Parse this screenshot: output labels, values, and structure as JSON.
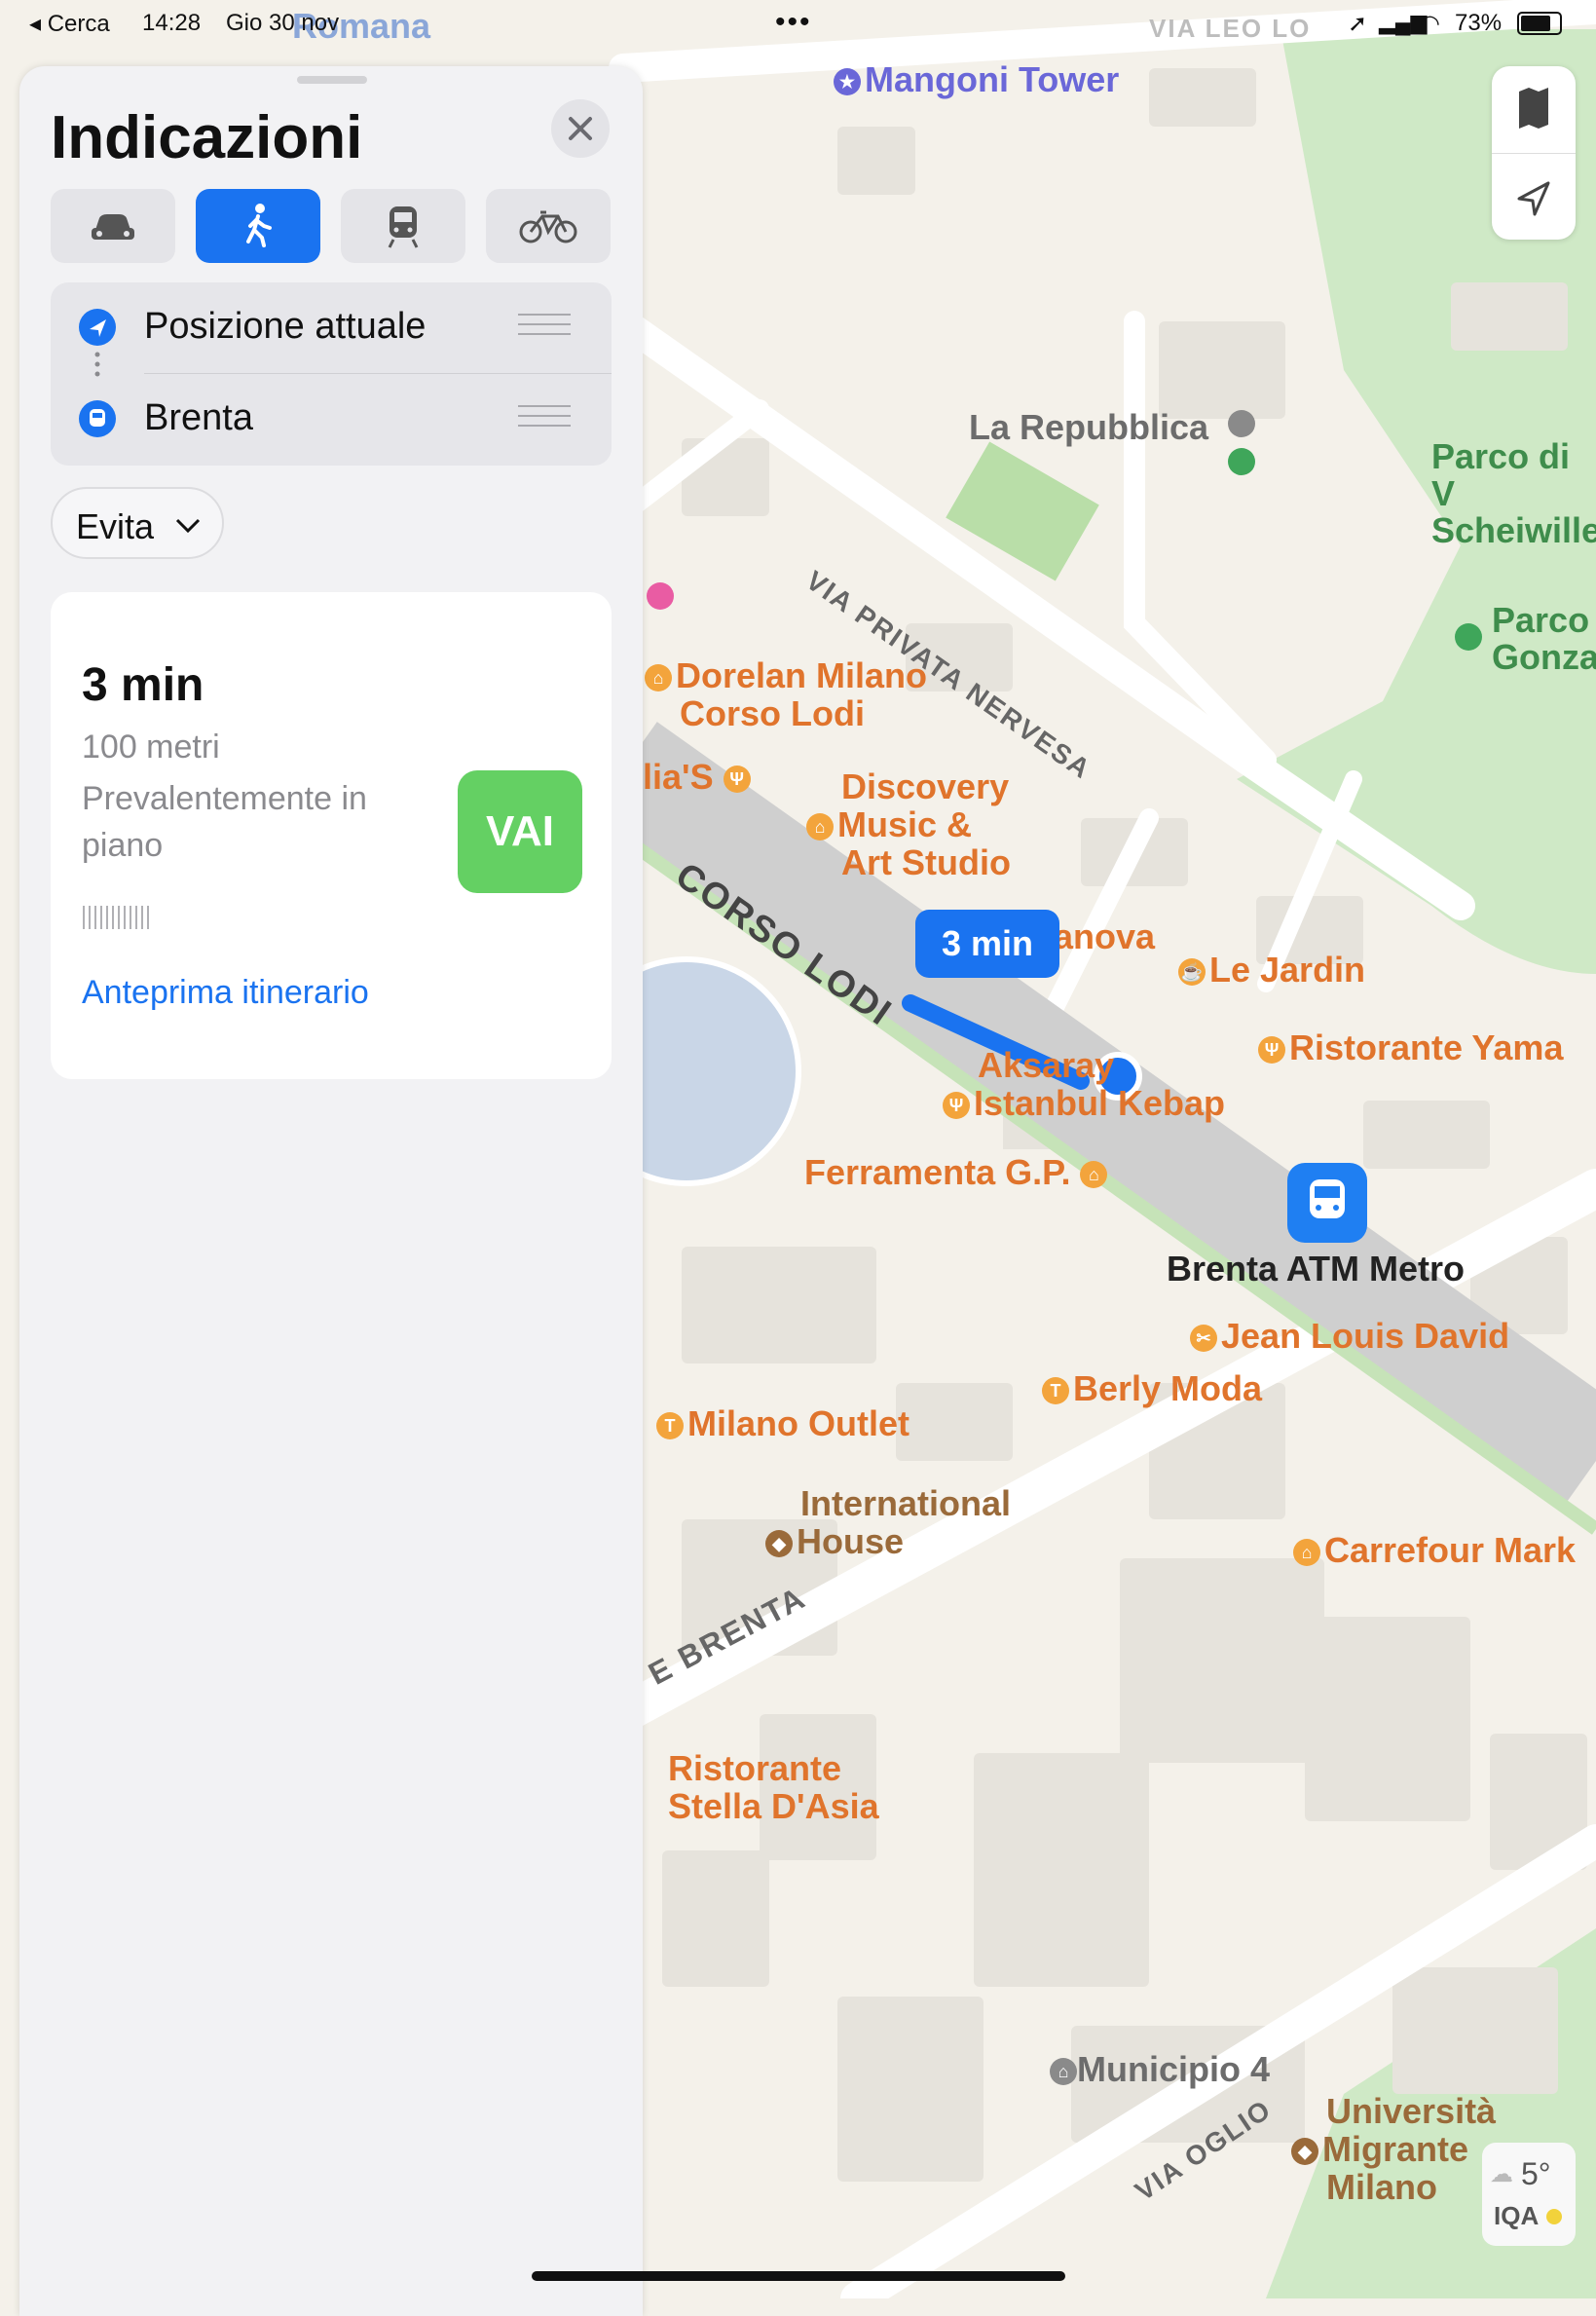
{
  "status_bar": {
    "back_app": "◂ Cerca",
    "time": "14:28",
    "date": "Gio 30 nov",
    "battery": "73%"
  },
  "panel": {
    "title": "Indicazioni",
    "modes": [
      "car",
      "walk",
      "transit",
      "bike"
    ],
    "active_mode": "walk",
    "origin": "Posizione attuale",
    "destination": "Brenta",
    "avoid_label": "Evita",
    "route": {
      "time": "3 min",
      "distance": "100 metri",
      "description": "Prevalentemente in piano",
      "go_label": "VAI",
      "preview_label": "Anteprima itinerario"
    }
  },
  "map": {
    "route_bubble": "3 min",
    "pois": {
      "mangoni": "Mangoni Tower",
      "repubblica": "La Repubblica",
      "parco1_line1": "Parco di V",
      "parco1_line2": "Scheiwille",
      "parco2_line1": "Parco",
      "parco2_line2": "Gonza",
      "dorelan_line1": "Dorelan Milano",
      "dorelan_line2": "Corso Lodi",
      "discovery_line1": "Discovery",
      "discovery_line2": "Music &",
      "discovery_line3": "Art Studio",
      "lias": "lia'S",
      "anova": "anova",
      "lejardin": "Le Jardin",
      "yama": "Ristorante Yama",
      "aksaray_line1": "Aksaray",
      "aksaray_line2": "Istanbul Kebap",
      "ferramenta": "Ferramenta G.P.",
      "brenta_metro": "Brenta ATM Metro",
      "jeanlouis": "Jean Louis David",
      "berly": "Berly Moda",
      "milano_outlet": "Milano Outlet",
      "international_line1": "International",
      "international_line2": "House",
      "carrefour": "Carrefour Mark",
      "stella_line1": "Ristorante",
      "stella_line2": "Stella D'Asia",
      "municipio": "Municipio 4",
      "universita_line1": "Università",
      "universita_line2": "Migrante",
      "universita_line3": "Milano"
    },
    "streets": {
      "nervesa": "VIA PRIVATA NERVESA",
      "corso_lodi": "CORSO LODI",
      "brenta": "E BRENTA",
      "oglio": "VIA OGLIO",
      "romana": "Romana",
      "leo": "VIA LEO LO"
    },
    "weather": {
      "temp": "5°",
      "aqi_label": "IQA"
    }
  },
  "colors": {
    "accent": "#1a73f0",
    "go": "#64d063",
    "poi": "#e0742c",
    "park": "#cfe9c6"
  }
}
